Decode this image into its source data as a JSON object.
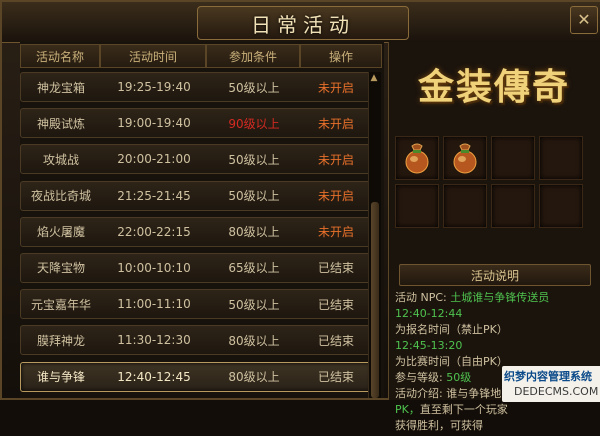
{
  "window": {
    "title": "日常活动",
    "close_glyph": "✕"
  },
  "table": {
    "headers": [
      "活动名称",
      "活动时间",
      "参加条件",
      "操作"
    ],
    "rows": [
      {
        "name": "神龙宝箱",
        "time": "19:25-19:40",
        "cond": "50级以上",
        "op": "未开启",
        "cond_color": "#cfc1a0",
        "op_color": "#e8702a"
      },
      {
        "name": "神殿试炼",
        "time": "19:00-19:40",
        "cond": "90级以上",
        "op": "未开启",
        "cond_color": "#d42a22",
        "op_color": "#e8702a"
      },
      {
        "name": "攻城战",
        "time": "20:00-21:00",
        "cond": "50级以上",
        "op": "未开启",
        "cond_color": "#cfc1a0",
        "op_color": "#e8702a"
      },
      {
        "name": "夜战比奇城",
        "time": "21:25-21:45",
        "cond": "50级以上",
        "op": "未开启",
        "cond_color": "#cfc1a0",
        "op_color": "#e8702a"
      },
      {
        "name": "焰火屠魔",
        "time": "22:00-22:15",
        "cond": "80级以上",
        "op": "未开启",
        "cond_color": "#cfc1a0",
        "op_color": "#e8702a"
      },
      {
        "name": "天降宝物",
        "time": "10:00-10:10",
        "cond": "65级以上",
        "op": "已结束",
        "cond_color": "#cfc1a0",
        "op_color": "#cfc1a0"
      },
      {
        "name": "元宝嘉年华",
        "time": "11:00-11:10",
        "cond": "50级以上",
        "op": "已结束",
        "cond_color": "#cfc1a0",
        "op_color": "#cfc1a0"
      },
      {
        "name": "膜拜神龙",
        "time": "11:30-12:30",
        "cond": "80级以上",
        "op": "已结束",
        "cond_color": "#cfc1a0",
        "op_color": "#cfc1a0"
      },
      {
        "name": "谁与争锋",
        "time": "12:40-12:45",
        "cond": "80级以上",
        "op": "已结束",
        "cond_color": "#cfc1a0",
        "op_color": "#cfc1a0"
      }
    ],
    "selected_index": 8
  },
  "logo": {
    "text": "金装傳奇"
  },
  "reward_slots": [
    {
      "item": "bag-icon"
    },
    {
      "item": "bag-icon"
    },
    {
      "item": ""
    },
    {
      "item": ""
    },
    {
      "item": ""
    },
    {
      "item": ""
    },
    {
      "item": ""
    },
    {
      "item": ""
    }
  ],
  "info": {
    "title": "活动说明",
    "npc_label": "活动 NPC:",
    "npc_value": "土城谁与争锋传送员",
    "signup_time": "12:40-12:44",
    "signup_label": "为报名时间（禁止PK）",
    "match_time": "12:45-13:20",
    "match_label": "为比赛时间（自由PK）",
    "level_label": "参与等级:",
    "level_value": "50级",
    "intro_label": "活动介绍: 谁与争锋地图内",
    "intro_value": "自由",
    "intro_line2_a": "PK，",
    "intro_line2_b": "直至剩下一个玩家",
    "intro_line3": "获得胜利，可获得"
  },
  "watermark": {
    "top": "织梦内容管理系统",
    "bottom": "DEDECMS.COM"
  }
}
